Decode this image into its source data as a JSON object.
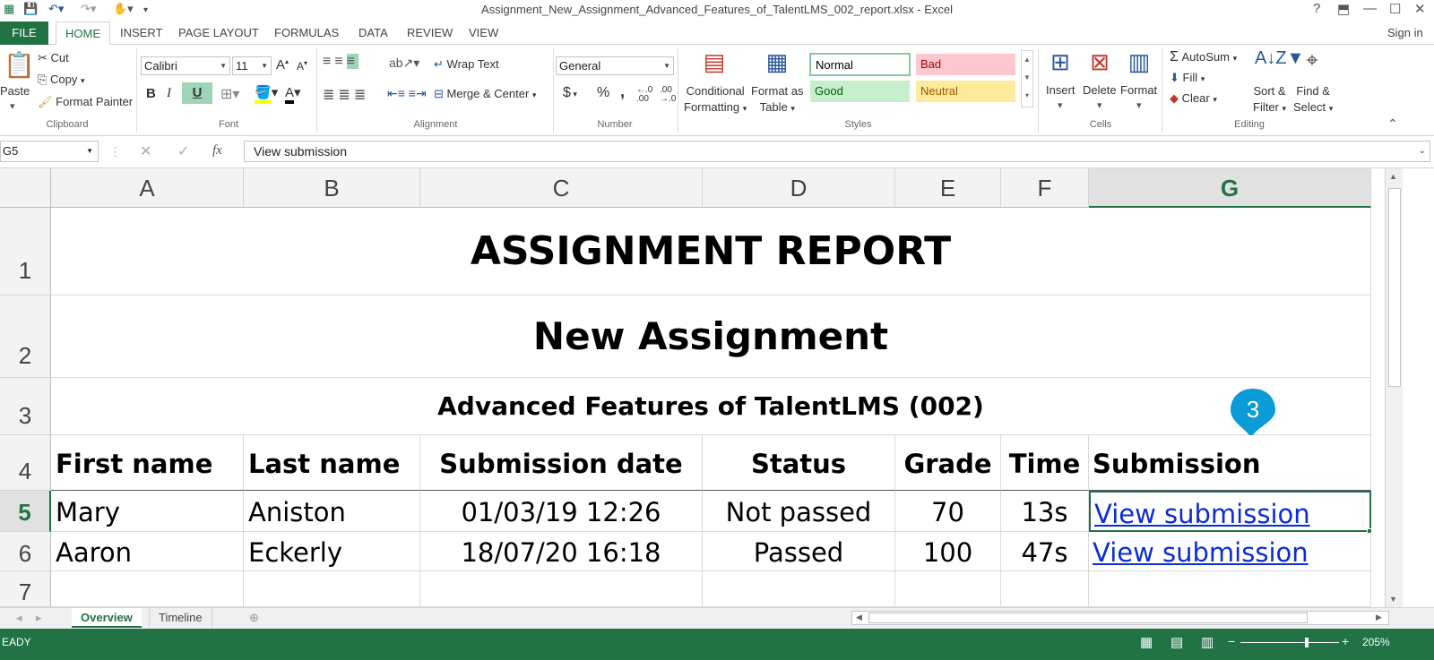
{
  "window": {
    "title": "Assignment_New_Assignment_Advanced_Features_of_TalentLMS_002_report.xlsx - Excel",
    "help": "?",
    "signin": "Sign in"
  },
  "tabs": [
    {
      "label": "FILE"
    },
    {
      "label": "HOME"
    },
    {
      "label": "INSERT"
    },
    {
      "label": "PAGE LAYOUT"
    },
    {
      "label": "FORMULAS"
    },
    {
      "label": "DATA"
    },
    {
      "label": "REVIEW"
    },
    {
      "label": "VIEW"
    }
  ],
  "ribbon": {
    "clipboard": {
      "paste": "Paste",
      "cut": "Cut",
      "copy": "Copy",
      "format_painter": "Format Painter",
      "group": "Clipboard"
    },
    "font": {
      "name": "Calibri",
      "size": "11",
      "group": "Font",
      "bold": "B",
      "italic": "I",
      "underline": "U"
    },
    "alignment": {
      "wrap": "Wrap Text",
      "merge": "Merge & Center",
      "group": "Alignment"
    },
    "number": {
      "format": "General",
      "currency": "$",
      "percent": "%",
      "comma": ",",
      "group": "Number"
    },
    "styles": {
      "conditional": "Conditional",
      "formatting": "Formatting",
      "format_as": "Format as",
      "table": "Table",
      "normal": "Normal",
      "bad": "Bad",
      "good": "Good",
      "neutral": "Neutral",
      "group": "Styles"
    },
    "cells": {
      "insert": "Insert",
      "delete": "Delete",
      "format": "Format",
      "group": "Cells"
    },
    "editing": {
      "autosum": "AutoSum",
      "fill": "Fill",
      "clear": "Clear",
      "sort": "Sort &",
      "filter": "Filter",
      "find": "Find &",
      "select": "Select",
      "group": "Editing"
    }
  },
  "formula_bar": {
    "name_box": "G5",
    "fx": "fx",
    "content": "View submission"
  },
  "columns": [
    "A",
    "B",
    "C",
    "D",
    "E",
    "F",
    "G"
  ],
  "rows": [
    "1",
    "2",
    "3",
    "4",
    "5",
    "6",
    "7"
  ],
  "sheet": {
    "title": "ASSIGNMENT REPORT",
    "subtitle": "New Assignment",
    "course": "Advanced Features of TalentLMS (002)",
    "headers": [
      "First name",
      "Last name",
      "Submission date",
      "Status",
      "Grade",
      "Time",
      "Submission"
    ],
    "data": [
      [
        "Mary",
        "Aniston",
        "01/03/19 12:26",
        "Not passed",
        "70",
        "13s",
        "View submission"
      ],
      [
        "Aaron",
        "Eckerly",
        "18/07/20 16:18",
        "Passed",
        "100",
        "47s",
        "View submission"
      ]
    ]
  },
  "sheet_tabs": [
    {
      "label": "Overview"
    },
    {
      "label": "Timeline"
    }
  ],
  "status": {
    "ready": "EADY",
    "zoom": "205%"
  },
  "marker": {
    "number": "3"
  },
  "colors": {
    "excel_green": "#217346",
    "link": "#0b2cd6",
    "marker": "#0a9bd8"
  }
}
